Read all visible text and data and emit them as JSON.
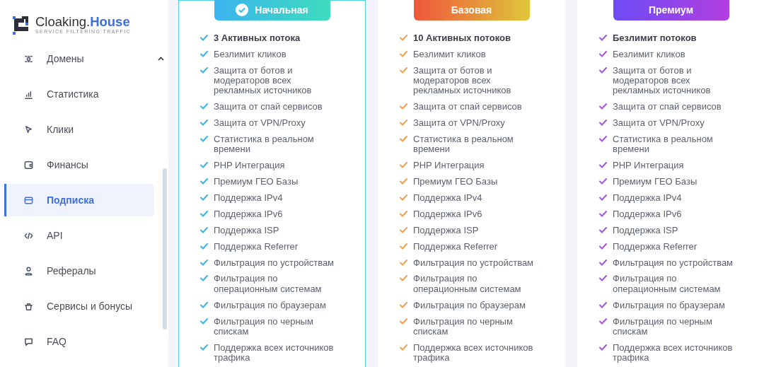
{
  "logo": {
    "name": "Cloaking.",
    "accent": "House",
    "tagline": "SERVICE FILTERING TRAFFIC"
  },
  "sidebar": {
    "items": [
      {
        "label": "Домены",
        "selected": false,
        "expanded": true
      },
      {
        "label": "Статистика",
        "selected": false
      },
      {
        "label": "Клики",
        "selected": false
      },
      {
        "label": "Финансы",
        "selected": false
      },
      {
        "label": "Подписка",
        "selected": true
      },
      {
        "label": "API",
        "selected": false
      },
      {
        "label": "Рефералы",
        "selected": false
      },
      {
        "label": "Сервисы и бонусы",
        "selected": false
      },
      {
        "label": "FAQ",
        "selected": false
      }
    ]
  },
  "plans": [
    {
      "name": "Начальная",
      "selected": true,
      "color": "#3ab3e6",
      "features": [
        "3 Активных потока",
        "Безлимит кликов",
        "Защита от ботов и модераторов всех рекламных источников",
        "Защита от спай сервисов",
        "Защита от VPN/Proxy",
        "Статистика в реальном времени",
        "PHP Интеграция",
        "Премиум ГЕО Базы",
        "Поддержка IPv4",
        "Поддержка IPv6",
        "Поддержка ISP",
        "Поддержка Referrer",
        "Фильтрация по устройствам",
        "Фильтрация по операционным системам",
        "Фильтрация по браузерам",
        "Фильтрация по черным спискам",
        "Поддержка всех источников трафика"
      ]
    },
    {
      "name": "Базовая",
      "selected": false,
      "color": "#f0a14a",
      "features": [
        "10 Активных потоков",
        "Безлимит кликов",
        "Защита от ботов и модераторов всех рекламных источников",
        "Защита от спай сервисов",
        "Защита от VPN/Proxy",
        "Статистика в реальном времени",
        "PHP Интеграция",
        "Премиум ГЕО Базы",
        "Поддержка IPv4",
        "Поддержка IPv6",
        "Поддержка ISP",
        "Поддержка Referrer",
        "Фильтрация по устройствам",
        "Фильтрация по операционным системам",
        "Фильтрация по браузерам",
        "Фильтрация по черным спискам",
        "Поддержка всех источников трафика"
      ]
    },
    {
      "name": "Премиум",
      "selected": false,
      "color": "#a457d8",
      "features": [
        "Безлимит потоков",
        "Безлимит кликов",
        "Защита от ботов и модераторов всех рекламных источников",
        "Защита от спай сервисов",
        "Защита от VPN/Proxy",
        "Статистика в реальном времени",
        "PHP Интеграция",
        "Премиум ГЕО Базы",
        "Поддержка IPv4",
        "Поддержка IPv6",
        "Поддержка ISP",
        "Поддержка Referrer",
        "Фильтрация по устройствам",
        "Фильтрация по операционным системам",
        "Фильтрация по браузерам",
        "Фильтрация по черным спискам",
        "Поддержка всех источников трафика"
      ]
    }
  ]
}
